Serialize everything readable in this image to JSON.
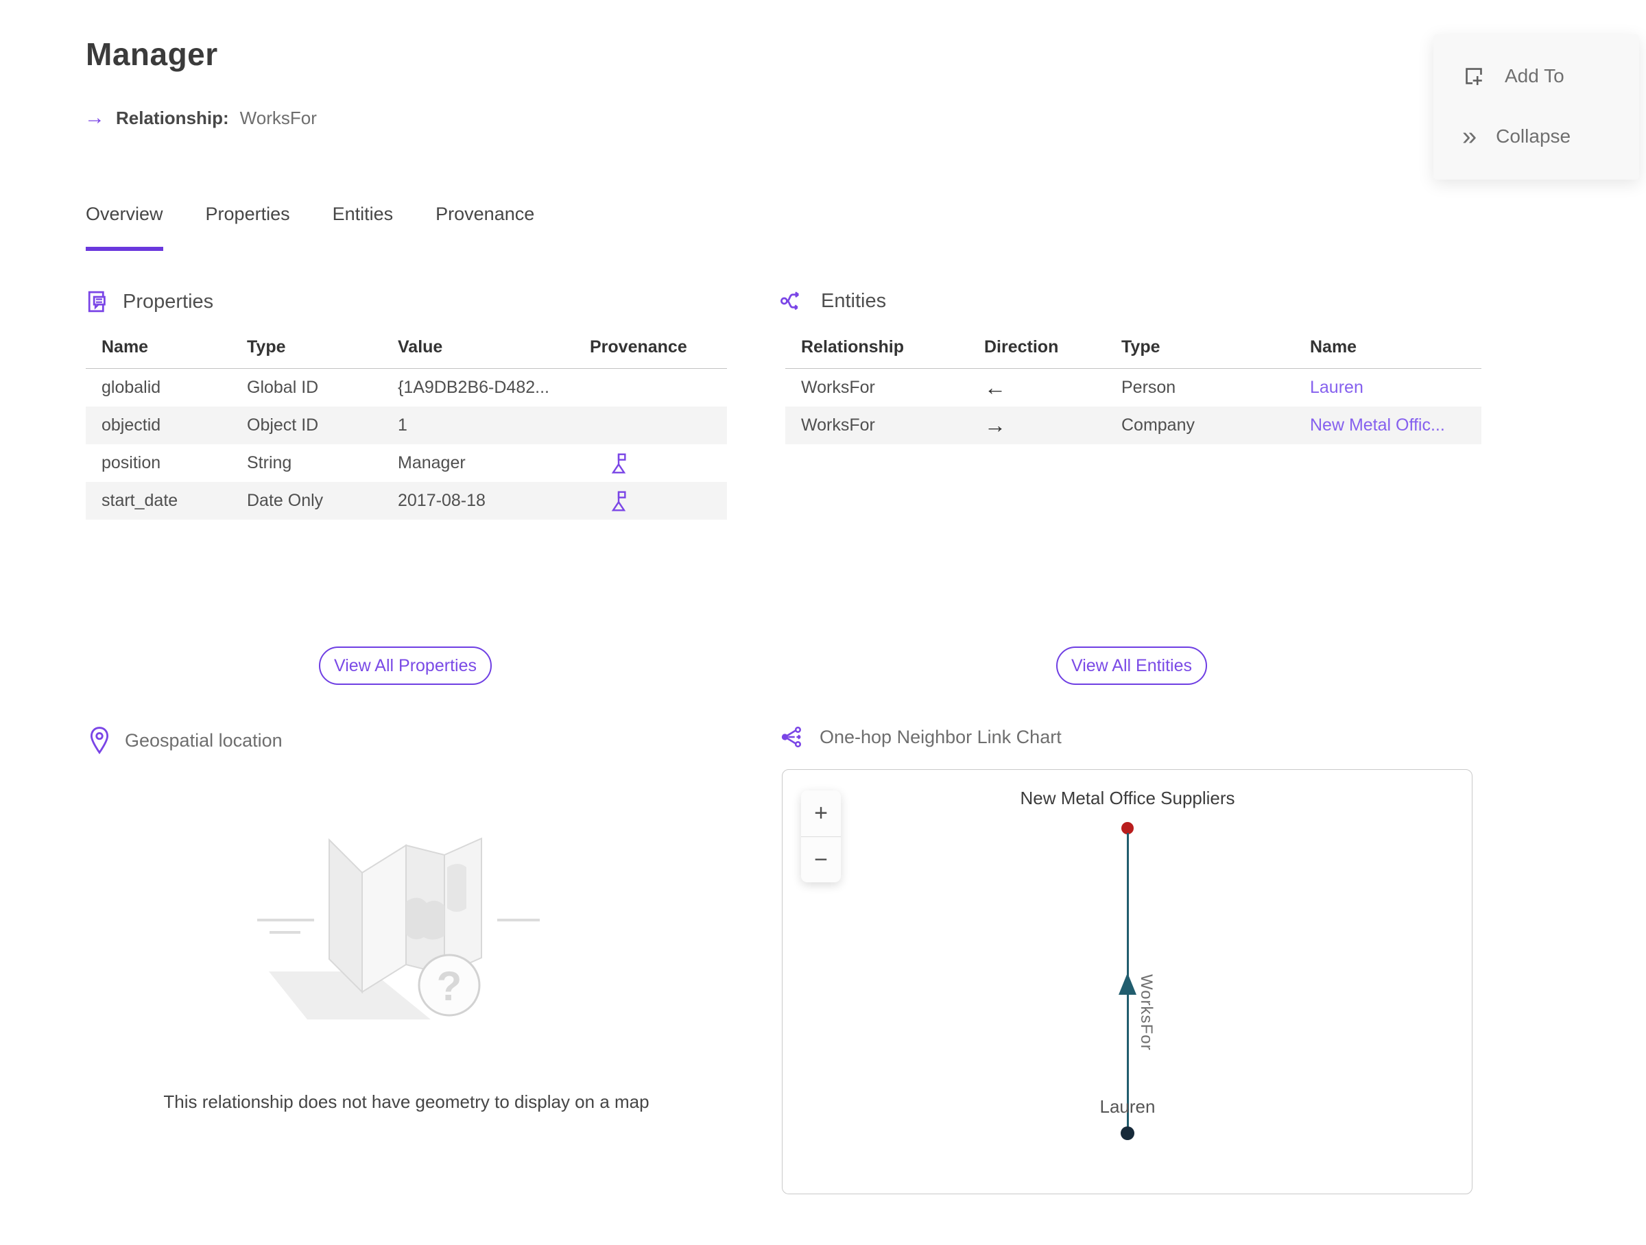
{
  "header": {
    "title": "Manager",
    "arrow": "→",
    "relationship_label": "Relationship:",
    "relationship_value": "WorksFor"
  },
  "actions": {
    "add_to": "Add To",
    "collapse": "Collapse",
    "collapse_glyph": "»"
  },
  "tabs": {
    "active": "Overview",
    "items": [
      {
        "label": "Overview"
      },
      {
        "label": "Properties"
      },
      {
        "label": "Entities"
      },
      {
        "label": "Provenance"
      }
    ]
  },
  "properties_section": {
    "title": "Properties",
    "columns": [
      "Name",
      "Type",
      "Value",
      "Provenance"
    ],
    "rows": [
      {
        "name": "globalid",
        "type": "Global ID",
        "value": "{1A9DB2B6-D482...",
        "provenance_flag": false
      },
      {
        "name": "objectid",
        "type": "Object ID",
        "value": "1",
        "provenance_flag": false
      },
      {
        "name": "position",
        "type": "String",
        "value": "Manager",
        "provenance_flag": true
      },
      {
        "name": "start_date",
        "type": "Date Only",
        "value": "2017-08-18",
        "provenance_flag": true
      }
    ],
    "view_all_label": "View All Properties"
  },
  "entities_section": {
    "title": "Entities",
    "columns": [
      "Relationship",
      "Direction",
      "Type",
      "Name"
    ],
    "rows": [
      {
        "relationship": "WorksFor",
        "direction": "←",
        "type": "Person",
        "name": "Lauren"
      },
      {
        "relationship": "WorksFor",
        "direction": "→",
        "type": "Company",
        "name": "New Metal Offic..."
      }
    ],
    "view_all_label": "View All Entities"
  },
  "geospatial_section": {
    "title": "Geospatial location",
    "empty_message": "This relationship does not have geometry to display on a map"
  },
  "link_chart_section": {
    "title": "One-hop Neighbor Link Chart",
    "zoom_in_label": "+",
    "zoom_out_label": "−",
    "graph": {
      "nodes": [
        {
          "label": "New Metal Office Suppliers",
          "color": "#b91d1d",
          "position": "top"
        },
        {
          "label": "Lauren",
          "color": "#172a3a",
          "position": "bottom"
        }
      ],
      "edge": {
        "label": "WorksFor",
        "color": "#215d6e",
        "from": "Lauren",
        "to": "New Metal Office Suppliers"
      }
    }
  },
  "colors": {
    "accent_purple": "#7a45e6",
    "link_purple": "#8560ee",
    "tab_underline": "#6a38dd",
    "edge_teal": "#215d6e",
    "node_red": "#b91d1d",
    "node_dark": "#172a3a",
    "row_alt": "#f4f4f4"
  }
}
